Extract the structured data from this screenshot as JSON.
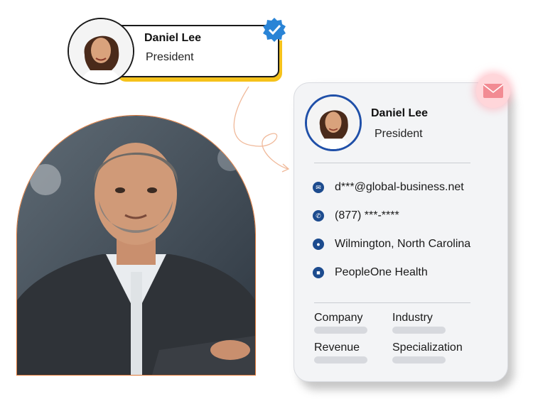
{
  "tag": {
    "name": "Daniel Lee",
    "title": "President"
  },
  "card": {
    "name": "Daniel Lee",
    "title": "President",
    "email": "d***@global-business.net",
    "phone": "(877) ***-****",
    "location": "Wilmington, North Carolina",
    "company_name": "PeopleOne Health",
    "fields": {
      "company": "Company",
      "industry": "Industry",
      "revenue": "Revenue",
      "specialization": "Specialization"
    }
  },
  "colors": {
    "accent_yellow": "#f5c21b",
    "icon_blue": "#1c4b8e",
    "badge_blue": "#2a84d6",
    "mail_pink": "#f4a6ad",
    "photo_border": "#e07a3a"
  },
  "icons": [
    "verified-badge-icon",
    "email-icon",
    "phone-icon",
    "location-pin-icon",
    "building-icon",
    "envelope-icon"
  ]
}
